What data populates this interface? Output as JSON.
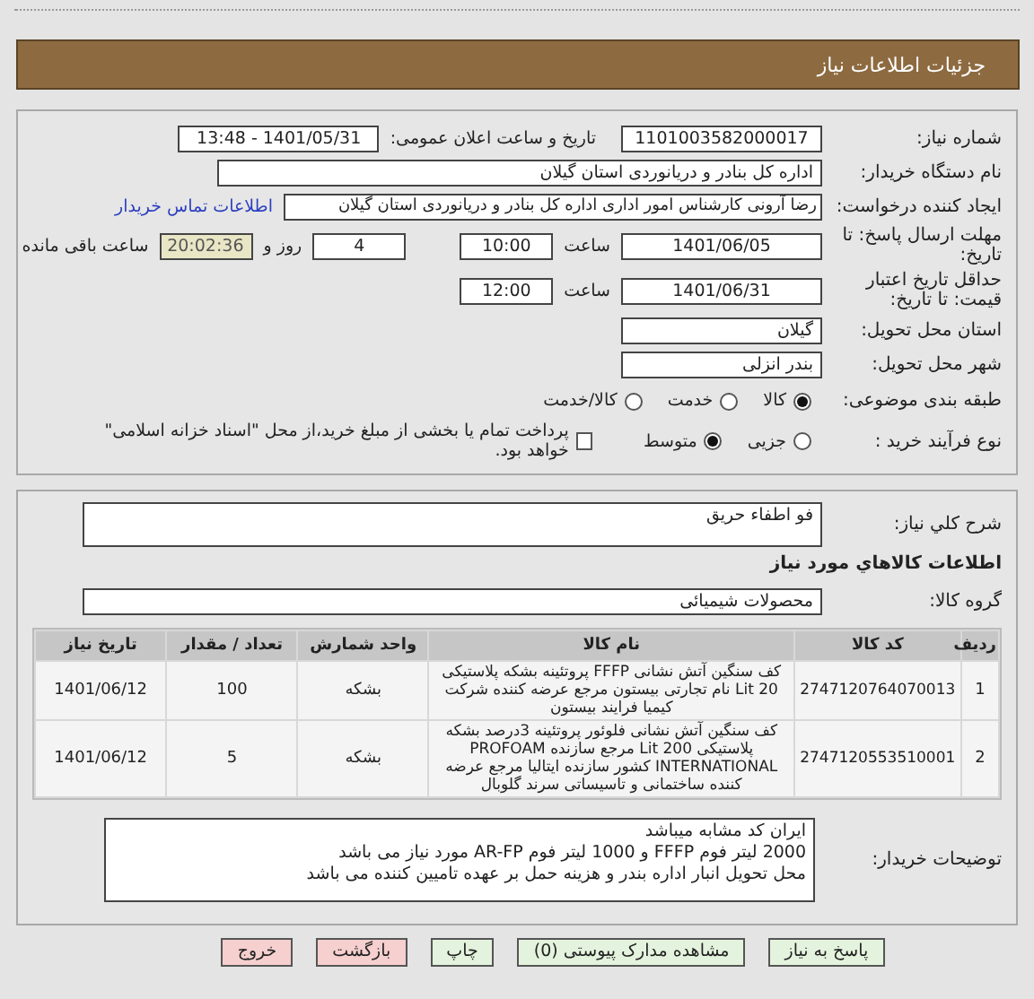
{
  "header": {
    "title": "جزئیات اطلاعات نیاز"
  },
  "need_number": {
    "label": "شماره نیاز:",
    "value": "1101003582000017"
  },
  "announce_datetime": {
    "label": "تاریخ و ساعت اعلان عمومی:",
    "value": "1401/05/31 - 13:48"
  },
  "buyer_org": {
    "label": "نام دستگاه خریدار:",
    "value": "اداره کل بنادر و دریانوردی استان گیلان"
  },
  "requester": {
    "label": "ایجاد کننده درخواست:",
    "value": "رضا آرونی کارشناس امور اداری اداره کل بنادر و دریانوردی استان گیلان",
    "contact_link": "اطلاعات تماس خریدار"
  },
  "response_deadline": {
    "label": "مهلت ارسال پاسخ: تا تاریخ:",
    "date": "1401/06/05",
    "time_label": "ساعت",
    "time": "10:00",
    "days": "4",
    "days_label": "روز و",
    "remaining": "20:02:36",
    "remaining_label": "ساعت باقی مانده"
  },
  "price_validity": {
    "label": "حداقل تاریخ اعتبار قیمت: تا تاریخ:",
    "date": "1401/06/31",
    "time_label": "ساعت",
    "time": "12:00"
  },
  "delivery_province": {
    "label": "استان محل تحویل:",
    "value": "گیلان"
  },
  "delivery_city": {
    "label": "شهر محل تحویل:",
    "value": "بندر انزلی"
  },
  "subject_category": {
    "label": "طبقه بندی موضوعی:",
    "options": [
      {
        "label": "کالا",
        "selected": true
      },
      {
        "label": "خدمت",
        "selected": false
      },
      {
        "label": "کالا/خدمت",
        "selected": false
      }
    ]
  },
  "purchase_process": {
    "label": "نوع فرآیند خرید :",
    "options": [
      {
        "label": "جزیی",
        "selected": false
      },
      {
        "label": "متوسط",
        "selected": true
      }
    ],
    "treasury_checkbox": {
      "label": "پرداخت تمام یا بخشی از مبلغ خرید،از محل \"اسناد خزانه اسلامی\" خواهد بود.",
      "checked": false
    }
  },
  "description": {
    "label": "شرح کلي نياز:",
    "value": "فو اطفاء حریق"
  },
  "goods_section_title": "اطلاعات کالاهاي مورد نياز",
  "goods_group": {
    "label": "گروه کالا:",
    "value": "محصولات شیمیائی"
  },
  "items_table": {
    "columns": [
      "ردیف",
      "کد کالا",
      "نام کالا",
      "واحد شمارش",
      "تعداد / مقدار",
      "تاریخ نیاز"
    ],
    "rows": [
      [
        "1",
        "2747120764070013",
        "کف سنگین آتش نشانی FFFP پروتئینه بشکه پلاستیکی 20 Lit نام تجارتی بیستون مرجع عرضه کننده شرکت کیمیا فرایند بیستون",
        "بشکه",
        "100",
        "1401/06/12"
      ],
      [
        "2",
        "2747120553510001",
        "کف سنگین آتش نشانی فلوئور پروتئینه 3درصد بشکه پلاستیکی 200 Lit مرجع سازنده PROFOAM INTERNATIONAL کشور سازنده ایتالیا مرجع عرضه کننده ساختمانی و تاسیساتی سرند گلوبال",
        "بشکه",
        "5",
        "1401/06/12"
      ]
    ]
  },
  "buyer_notes": {
    "label": "توضیحات خریدار:",
    "lines": [
      "ایران کد مشابه میباشد",
      "2000 لیتر فوم FFFP و 1000 لیتر فوم AR-FP مورد نیاز می باشد",
      "محل تحویل انبار اداره بندر و هزینه حمل بر عهده تامیین کننده می باشد"
    ]
  },
  "buttons": [
    {
      "label": "پاسخ به نیاز",
      "kind": "primary"
    },
    {
      "label": "مشاهده مدارک پیوستی (0)",
      "kind": "primary"
    },
    {
      "label": "چاپ",
      "kind": "primary"
    },
    {
      "label": "بازگشت",
      "kind": "danger"
    },
    {
      "label": "خروج",
      "kind": "danger"
    }
  ]
}
